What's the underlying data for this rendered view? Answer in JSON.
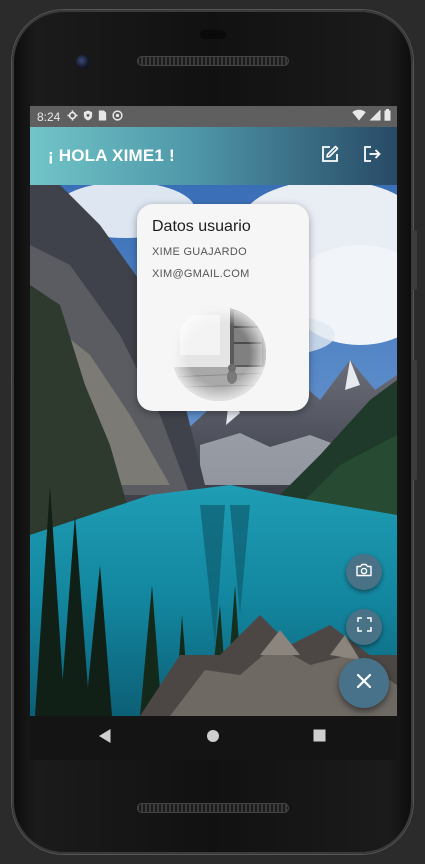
{
  "status_bar": {
    "time": "8:24",
    "left_icons": [
      "settings-icon",
      "shield-icon",
      "sim-card-icon",
      "sync-icon"
    ],
    "right_icons": [
      "wifi-icon",
      "signal-icon",
      "battery-icon"
    ]
  },
  "app_bar": {
    "title": "¡ HOLA XIME1 !",
    "actions": [
      "edit-icon",
      "logout-icon"
    ],
    "gradient": [
      "#71c5c8",
      "#284a66"
    ]
  },
  "user_card": {
    "title": "Datos usuario",
    "name": "XIME GUAJARDO",
    "email": "XIM@GMAIL.COM"
  },
  "fab": {
    "camera_icon": "camera-icon",
    "scan_icon": "scan-icon",
    "close_icon": "close-icon",
    "color": "#48718a"
  },
  "nav_bar": {
    "buttons": [
      "back-icon",
      "home-icon",
      "recents-icon"
    ]
  }
}
